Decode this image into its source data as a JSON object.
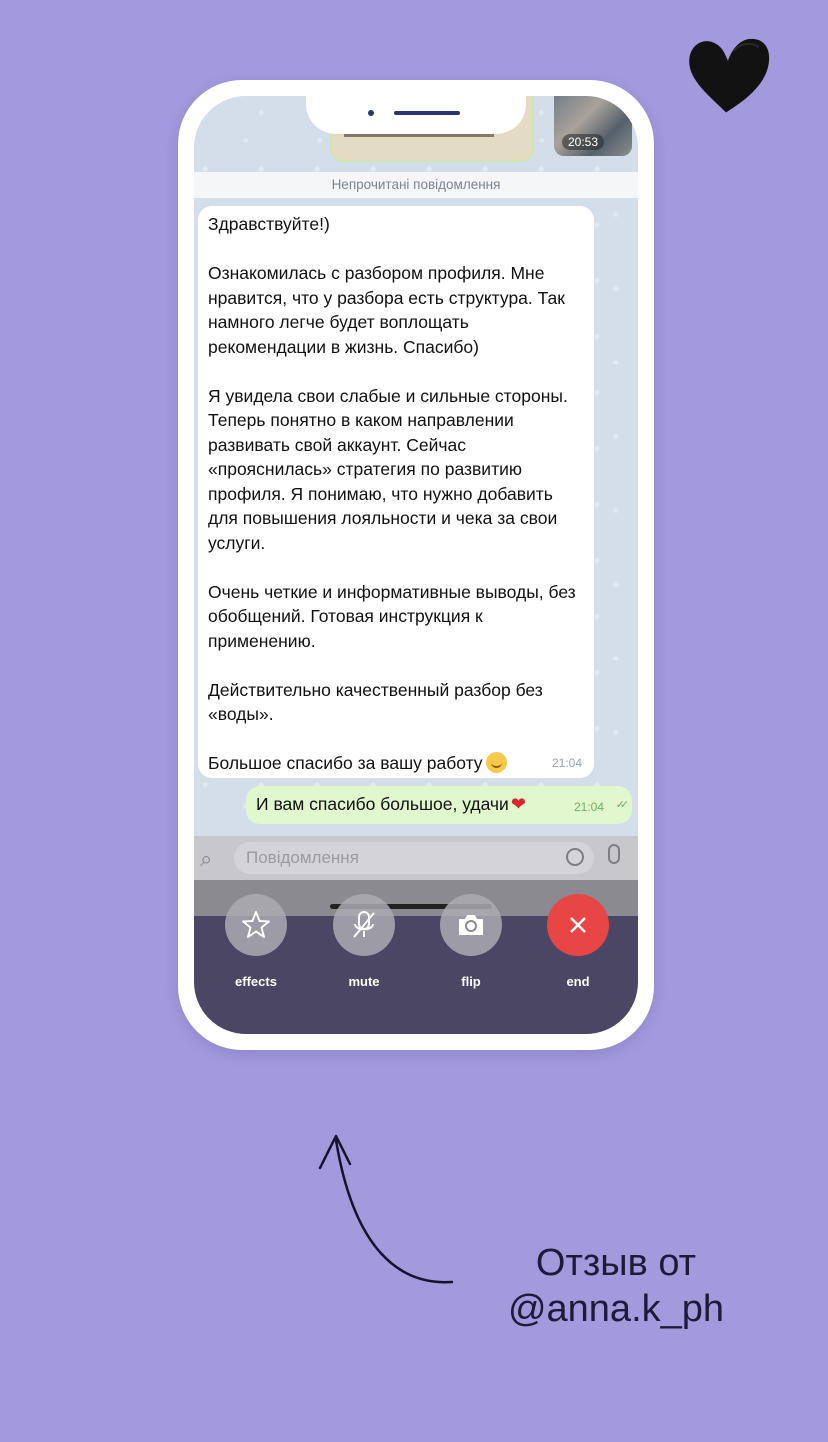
{
  "chat": {
    "unread_banner": "Непрочитані повідомлення",
    "previous_message_time": "20:53",
    "incoming_message": {
      "text": "Здравствуйте!)\n\nОзнакомилась с разбором профиля. Мне нравится, что у разбора есть структура. Так намного легче будет воплощать рекомендации в жизнь. Спасибо)\n\nЯ увидела свои слабые и сильные стороны. Теперь понятно в каком направлении развивать свой аккаунт. Сейчас «прояснилась» стратегия по развитию профиля. Я понимаю, что нужно добавить для повышения лояльности и чека за свои услуги.\n\nОчень четкие и информативные выводы, без обобщений. Готовая инструкция к применению.\n\nДействительно качественный разбор без «воды».\n\nБольшое спасибо за вашу работу",
      "emoji": "smiling-face",
      "time": "21:04"
    },
    "outgoing_message": {
      "text": "И вам спасибо большое, удачи",
      "emoji": "❤",
      "time": "21:04",
      "status": "read"
    },
    "input": {
      "placeholder": "Повідомлення",
      "value": ""
    }
  },
  "call_controls": {
    "effects_label": "effects",
    "mute_label": "mute",
    "flip_label": "flip",
    "end_label": "end"
  },
  "caption": {
    "line1": "Отзыв от",
    "line2": "@anna.k_ph"
  },
  "colors": {
    "background": "#a39ade",
    "end_call": "#e84545",
    "outgoing_bubble": "#e1f7cd"
  }
}
